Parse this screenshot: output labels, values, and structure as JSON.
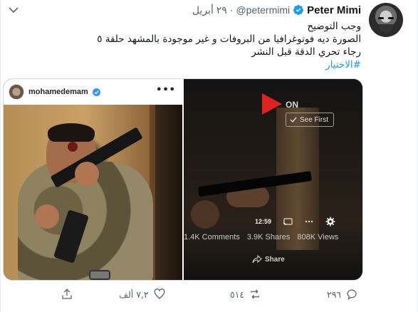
{
  "author": {
    "name": "Peter Mimi",
    "handle": "@petermimi",
    "separator": "·",
    "date": "٢٩ أبريل"
  },
  "tweet": {
    "line1": "وجب التوضيح",
    "line2": "الصورة ديه فوتوغرافيا من البروفات و غير موجودة بالمشهد حلقة ٥",
    "line3": "رجاء تحري الدقة قبل النشر",
    "hashtag": "#الاختيار"
  },
  "media": {
    "left": {
      "username": "mohamedemam",
      "menu": "•••"
    },
    "right": {
      "logo_text": "ON",
      "see_first_label": "See First",
      "duration": "12:59",
      "comments": "1.4K Comments",
      "shares": "3.9K Shares",
      "views": "808K Views",
      "share_label": "Share"
    }
  },
  "actions": {
    "replies": "٢٩٦",
    "retweets": "٥١٤",
    "likes": "٧,٢ ألف"
  },
  "colors": {
    "accent": "#1d9bf0",
    "muted": "#536471",
    "logo_red": "#e02121"
  }
}
